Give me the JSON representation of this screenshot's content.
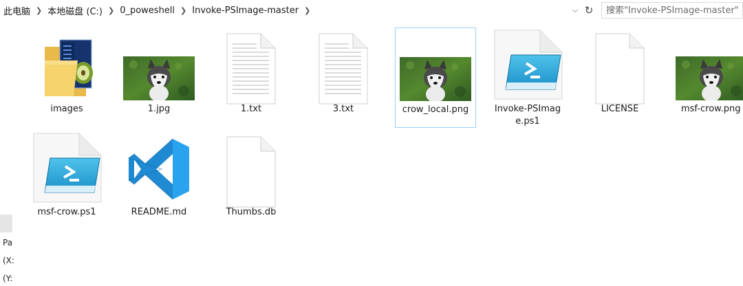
{
  "breadcrumb": [
    "此电脑",
    "本地磁盘 (C:)",
    "0_poweshell",
    "Invoke-PSImage-master"
  ],
  "search": {
    "placeholder": "搜索\"Invoke-PSImage-master\""
  },
  "left_pane": {
    "texts": [
      "Pa",
      "(X:",
      "(Y:"
    ]
  },
  "files": [
    {
      "name": "images",
      "icon": "folder-icon"
    },
    {
      "name": "1.jpg",
      "icon": "image-thumbnail"
    },
    {
      "name": "1.txt",
      "icon": "text-file-icon"
    },
    {
      "name": "3.txt",
      "icon": "text-file-icon"
    },
    {
      "name": "crow_local.png",
      "icon": "image-thumbnail",
      "selected": true
    },
    {
      "name": "Invoke-PSImage.ps1",
      "icon": "powershell-script-icon"
    },
    {
      "name": "LICENSE",
      "icon": "blank-file-icon"
    },
    {
      "name": "msf-crow.png",
      "icon": "image-thumbnail"
    },
    {
      "name": "msf-crow.ps1",
      "icon": "powershell-script-icon"
    },
    {
      "name": "README.md",
      "icon": "vscode-icon"
    },
    {
      "name": "Thumbs.db",
      "icon": "blank-file-icon"
    }
  ]
}
